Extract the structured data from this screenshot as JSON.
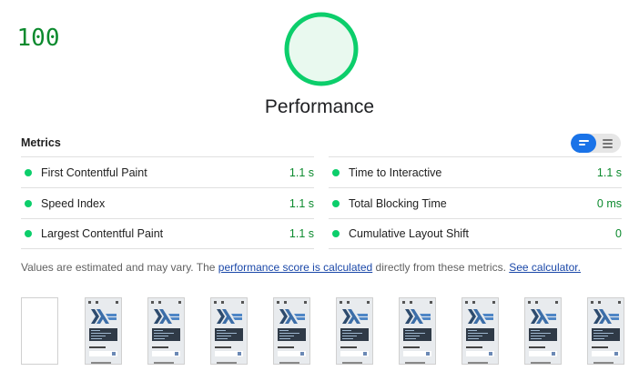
{
  "score": {
    "value": "100",
    "label": "Performance",
    "color": "#0cce6b",
    "ring_fill": "#e9f9ef",
    "fraction": 1.0
  },
  "metrics": {
    "title": "Metrics",
    "view_toggle": {
      "selected": "list-view",
      "options": [
        "list-view",
        "table-view"
      ]
    },
    "items": [
      {
        "label": "First Contentful Paint",
        "value": "1.1 s",
        "status": "pass"
      },
      {
        "label": "Time to Interactive",
        "value": "1.1 s",
        "status": "pass"
      },
      {
        "label": "Speed Index",
        "value": "1.1 s",
        "status": "pass"
      },
      {
        "label": "Total Blocking Time",
        "value": "0 ms",
        "status": "pass"
      },
      {
        "label": "Largest Contentful Paint",
        "value": "1.1 s",
        "status": "pass"
      },
      {
        "label": "Cumulative Layout Shift",
        "value": "0",
        "status": "pass"
      }
    ],
    "pass_color": "#0cce6b"
  },
  "note": {
    "before": "Values are estimated and may vary. The ",
    "link1": "performance score is calculated",
    "middle": " directly from these metrics. ",
    "link2": "See calculator."
  },
  "filmstrip": {
    "frames": [
      "blank",
      "page",
      "page",
      "page",
      "page",
      "page",
      "page",
      "page",
      "page",
      "page"
    ],
    "thumb_text": {
      "toc": "Table of Contents"
    }
  }
}
